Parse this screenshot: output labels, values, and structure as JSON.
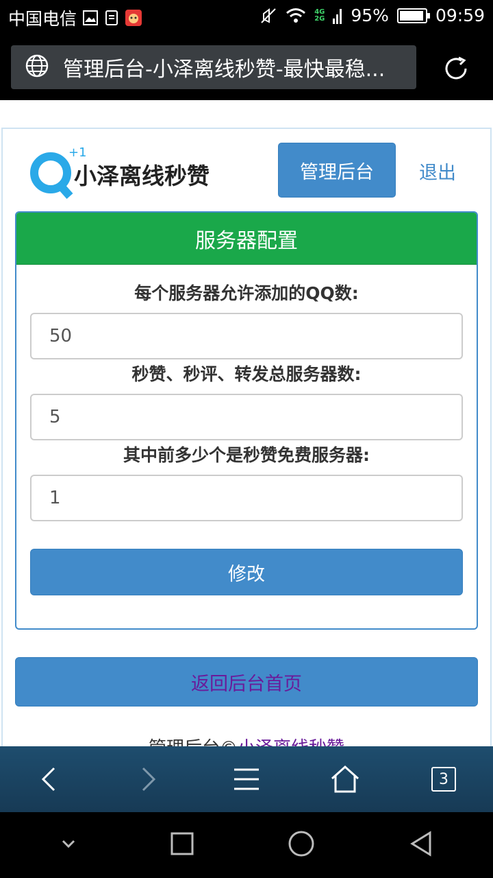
{
  "status_bar": {
    "carrier": "中国电信",
    "network": [
      "4G",
      "2G"
    ],
    "battery_percent": "95%",
    "battery_level": 0.95,
    "time": "09:59"
  },
  "browser": {
    "page_title": "管理后台-小泽离线秒赞-最快最稳...",
    "tab_count": "3"
  },
  "header": {
    "logo_plus": "+1",
    "brand": "小泽离线秒赞",
    "admin_button": "管理后台",
    "logout_link": "退出"
  },
  "panel": {
    "title": "服务器配置",
    "fields": [
      {
        "label": "每个服务器允许添加的QQ数:",
        "value": "50"
      },
      {
        "label": "秒赞、秒评、转发总服务器数:",
        "value": "5"
      },
      {
        "label": "其中前多少个是秒赞免费服务器:",
        "value": "1"
      }
    ],
    "submit_label": "修改"
  },
  "back_button": "返回后台首页",
  "footer": {
    "prefix": "管理后台©",
    "link": "小泽离线秒赞"
  },
  "colors": {
    "primary": "#428bca",
    "panel_header": "#1aa84a",
    "link_visited": "#6a1b9a",
    "nav_bar": "#1e4d6e"
  }
}
